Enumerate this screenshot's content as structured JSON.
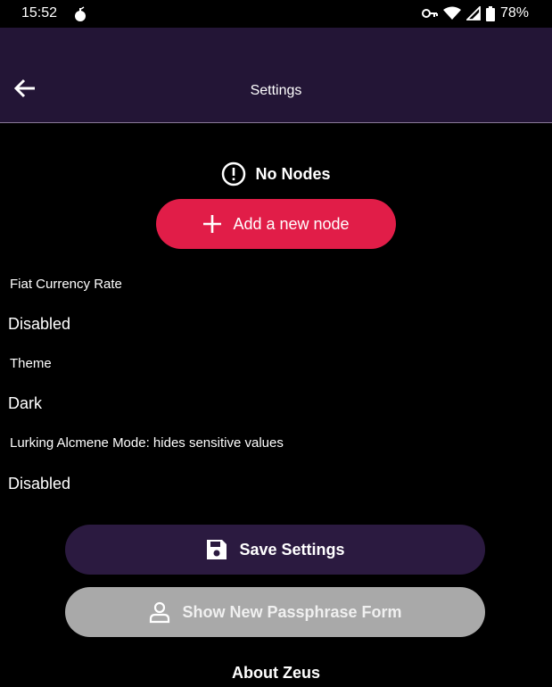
{
  "status": {
    "time": "15:52",
    "battery": "78%"
  },
  "header": {
    "title": "Settings"
  },
  "nodes": {
    "empty_label": "No Nodes",
    "add_label": "Add a new node"
  },
  "settings": [
    {
      "label": "Fiat Currency Rate",
      "value": "Disabled"
    },
    {
      "label": "Theme",
      "value": "Dark"
    },
    {
      "label": "Lurking Alcmene Mode: hides sensitive values",
      "value": "Disabled"
    }
  ],
  "buttons": {
    "save_label": "Save Settings",
    "passphrase_label": "Show New Passphrase Form",
    "about_label": "About Zeus"
  },
  "colors": {
    "header_bg": "#231536",
    "add_button": "#e11d48",
    "save_button": "#2b1a40",
    "passphrase_button": "#a9a9a9"
  }
}
